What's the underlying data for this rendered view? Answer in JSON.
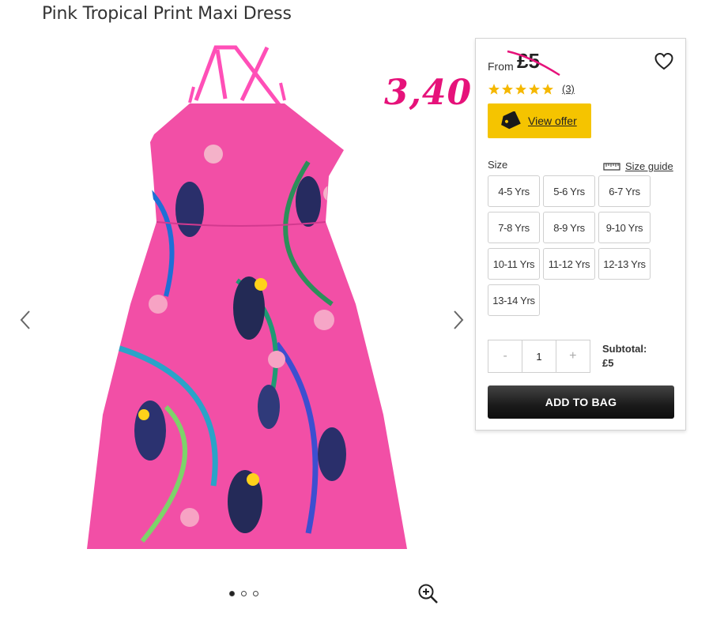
{
  "product": {
    "title": "Pink Tropical Print Maxi Dress",
    "price_prefix": "From",
    "price": "£5",
    "annotation": "3,40",
    "rating_value": 5,
    "rating_count": "(3)",
    "offer_label": "View offer"
  },
  "size": {
    "label": "Size",
    "guide_label": "Size guide",
    "options": [
      "4-5 Yrs",
      "5-6 Yrs",
      "6-7 Yrs",
      "7-8 Yrs",
      "8-9 Yrs",
      "9-10 Yrs",
      "10-11 Yrs",
      "11-12 Yrs",
      "12-13 Yrs",
      "13-14 Yrs"
    ]
  },
  "quantity": {
    "minus": "-",
    "value": "1",
    "plus": "+"
  },
  "subtotal": {
    "label": "Subtotal:",
    "value": "£5"
  },
  "add_to_bag": "ADD TO BAG",
  "gallery": {
    "image_count": 3,
    "active_index": 0
  },
  "colors": {
    "accent_yellow": "#f5c400",
    "annotation_pink": "#e6127a",
    "star_gold": "#f5b800",
    "dress_pink": "#f04fa8"
  },
  "icons": {
    "prev": "chevron-left-icon",
    "next": "chevron-right-icon",
    "wishlist": "heart-icon",
    "offer": "tag-icon",
    "size_guide": "ruler-icon",
    "zoom": "zoom-in-icon",
    "rating": "star-icon"
  }
}
